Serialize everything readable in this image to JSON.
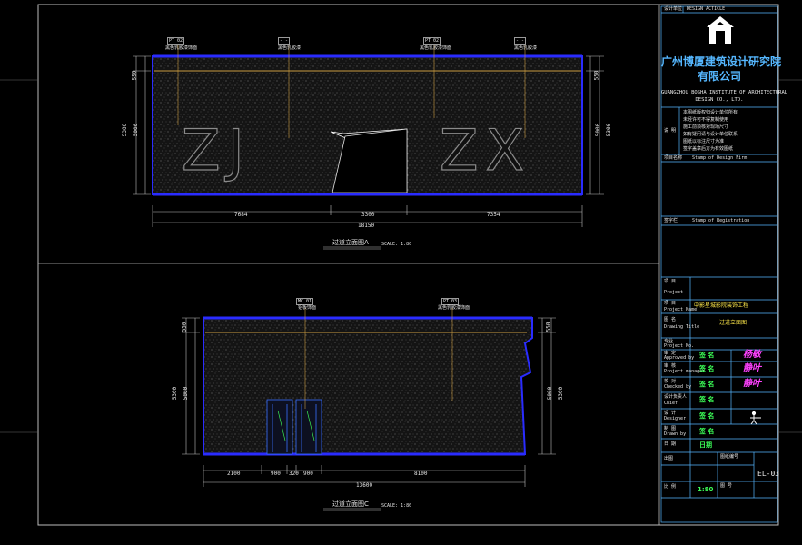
{
  "title_block": {
    "header_left": "设计单位",
    "header_right": "DESIGN ACTICLE",
    "company_cn_line1": "广州博厦建筑设计研究院",
    "company_cn_line2": "有限公司",
    "company_en_line1": "GUANGZHOU BOSHA INSTITUTE OF ARCHITECTURAL",
    "company_en_line2": "DESIGN CO., LTD.",
    "project_label": "项目名称",
    "project_value": "Stamp of Design Firm",
    "stage_label": "签字栏",
    "stage_value": "Stamp of Registration",
    "rows": [
      {
        "label": "项 目",
        "en": "Project",
        "value": ""
      },
      {
        "label": "项 目",
        "en": "Project Name",
        "value": "中影星城影院装饰工程"
      },
      {
        "label": "图 名",
        "en": "Drawing Title",
        "value": "过道立面图"
      },
      {
        "label": "专业",
        "en": "Project No.",
        "value": ""
      },
      {
        "label": "审 定",
        "en": "Approved by",
        "value": "签 名",
        "sign": "杨敏"
      },
      {
        "label": "审 核",
        "en": "Project manager",
        "value": "签 名",
        "sign": "静叶"
      },
      {
        "label": "校 对",
        "en": "Checked by",
        "value": "签 名",
        "sign": "静叶"
      },
      {
        "label": "设计负责人",
        "en": "Chief",
        "value": "签 名",
        "sign": ""
      },
      {
        "label": "设 计",
        "en": "Designer",
        "value": "签 名",
        "sign": ""
      },
      {
        "label": "制 图",
        "en": "Drawn by",
        "value": "签 名",
        "sign": ""
      }
    ],
    "date_label": "日 期",
    "date_value": "日期",
    "scale_label": "比 例",
    "scale_value": "1:80",
    "sheet_no_label": "图 号",
    "sheet_no": "EL-03",
    "notes": [
      "本图纸版权归设计单位所有",
      "未经许可不得复制使用",
      "施工前须核对现场尺寸",
      "如有疑问请与设计单位联系",
      "图纸以标注尺寸为准",
      "签字盖章后方为有效图纸"
    ]
  },
  "top_view": {
    "caption": "过道立面图A",
    "scale": "SCALE: 1:80",
    "letters_left": "ZJ",
    "letters_right": "ZX",
    "tags": [
      "PT 02",
      "- -",
      "PT 02",
      "- -"
    ],
    "tag_notes": [
      "黑色乳胶漆饰面",
      "黑色乳胶漆",
      "黑色乳胶漆饰面",
      "黑色乳胶漆"
    ],
    "dims_bottom": [
      "7684",
      "3300",
      "7354"
    ],
    "dim_total": "18150",
    "dims_left": [
      "550",
      "5000",
      "5300"
    ],
    "dims_right": [
      "550",
      "5000",
      "5300"
    ]
  },
  "bottom_view": {
    "caption": "过道立面图C",
    "scale": "SCALE: 1:80",
    "tags": [
      "MC 01",
      "PT 03"
    ],
    "tag_notes": [
      "铝板饰面",
      "黑色乳胶漆饰面"
    ],
    "dims_bottom": [
      "2100",
      "900",
      "320",
      "900",
      "8100"
    ],
    "dim_total": "13600",
    "dims_left": [
      "550",
      "5000",
      "5300"
    ],
    "dims_right": [
      "550",
      "5000",
      "5300"
    ]
  },
  "colors": {
    "frame": "#c8c8c8",
    "blue": "#2a2cff",
    "orange": "#c89a40",
    "cyan": "#55b7ff",
    "green": "#3cff58",
    "magenta": "#ff41ff"
  }
}
